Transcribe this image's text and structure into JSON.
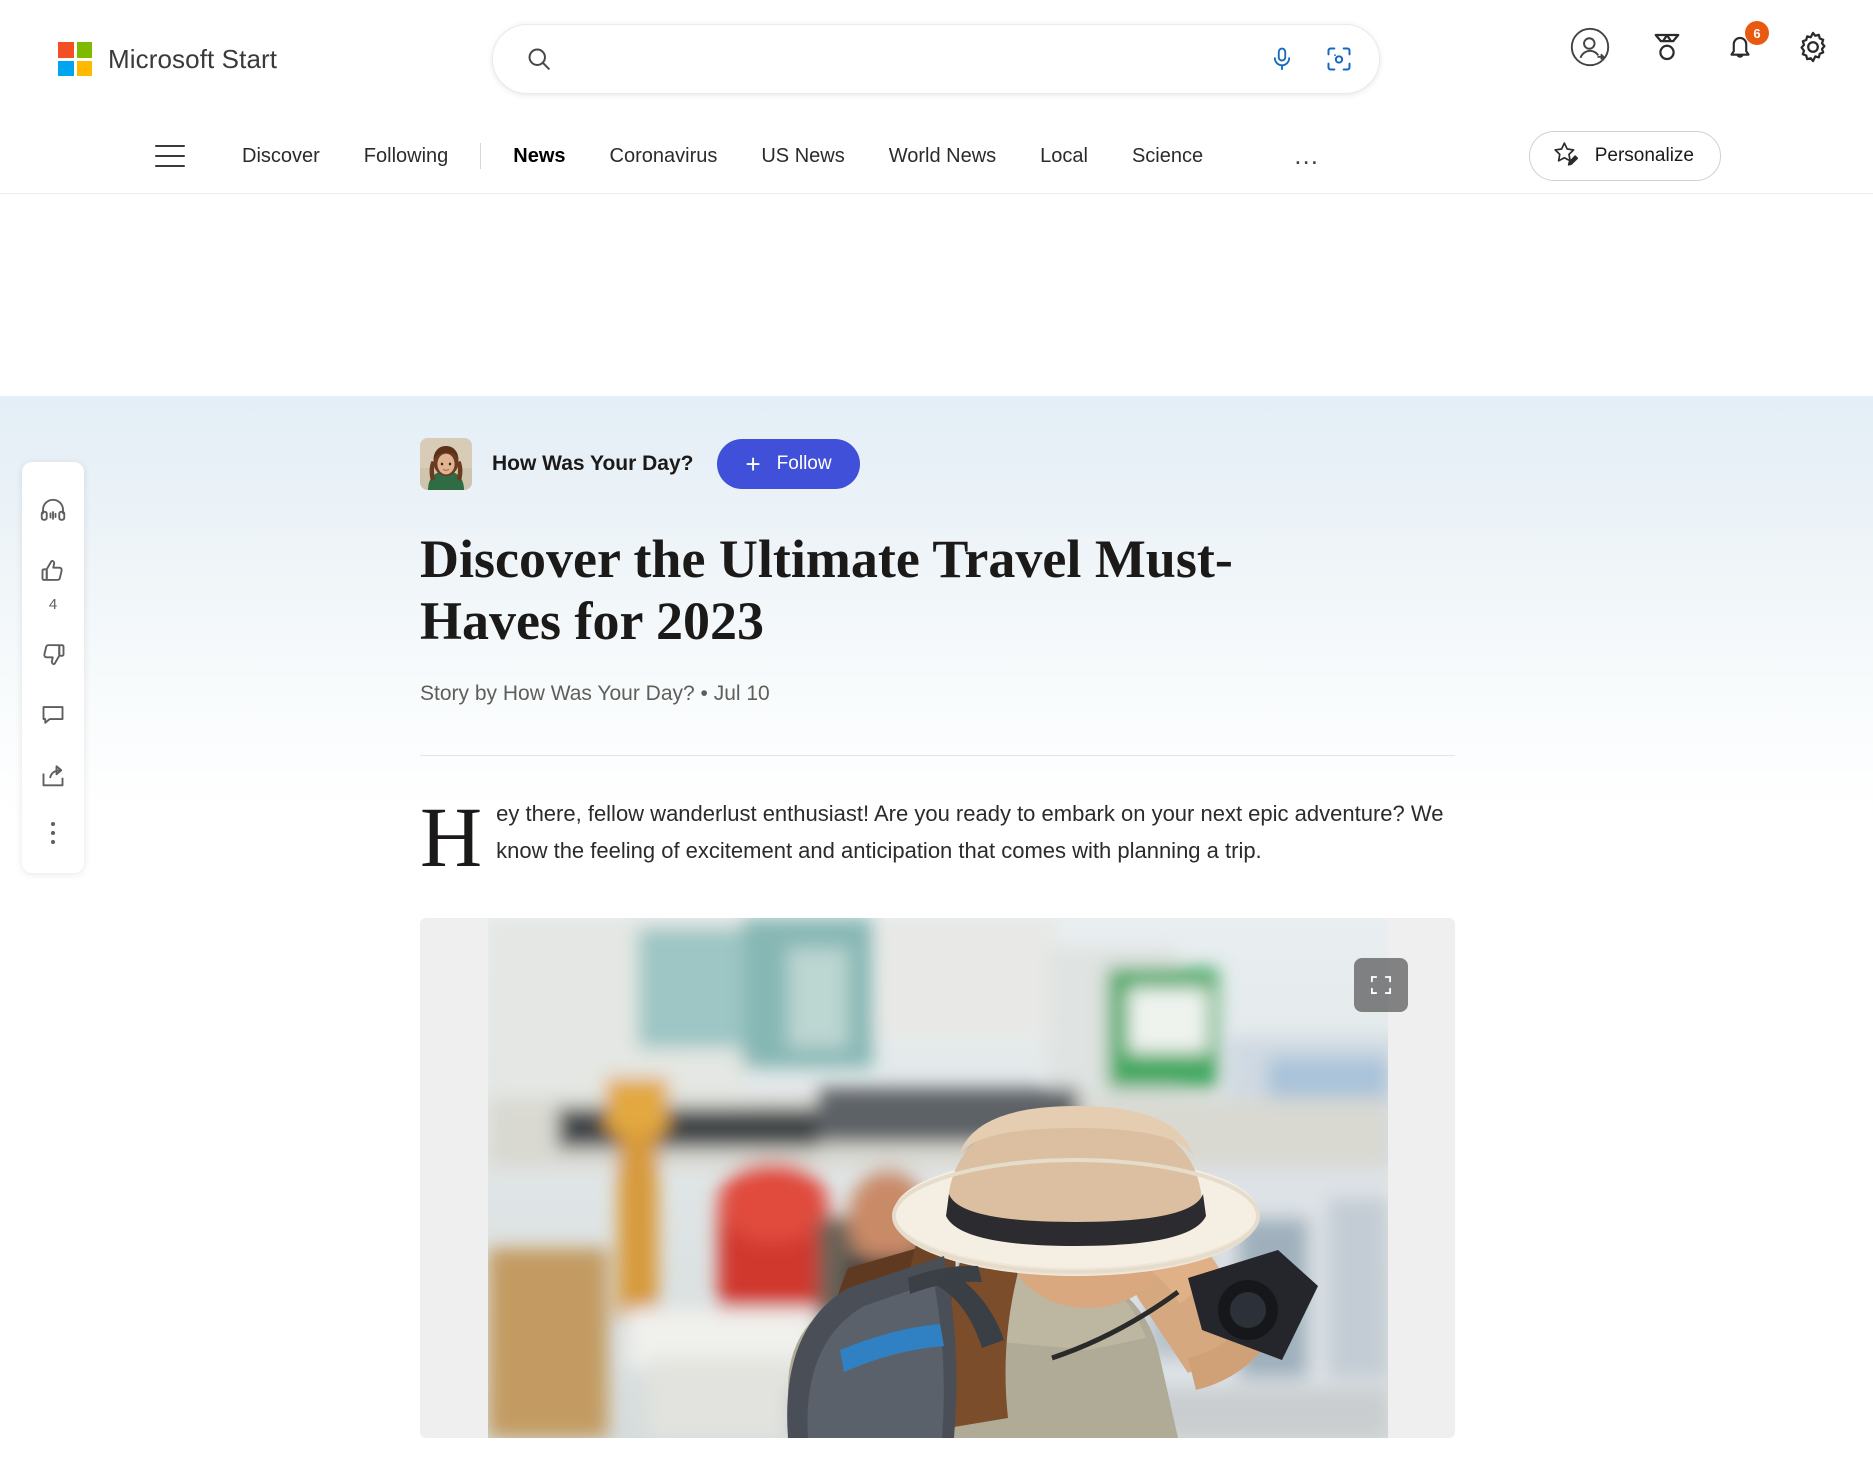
{
  "header": {
    "brand": "Microsoft Start",
    "logo_colors": [
      "#f25022",
      "#7fba00",
      "#00a4ef",
      "#ffb900"
    ],
    "search": {
      "value": "",
      "placeholder": "",
      "icons": [
        "search-icon",
        "microphone-icon",
        "visual-search-icon"
      ],
      "accent": "#0f6cbd"
    },
    "right_icons": [
      {
        "name": "sign-in-avatar-icon",
        "label": "Sign in"
      },
      {
        "name": "rewards-medal-icon",
        "label": "Rewards"
      },
      {
        "name": "notifications-bell-icon",
        "label": "Notifications",
        "badge": "6",
        "badge_color": "#e95a10"
      },
      {
        "name": "settings-gear-icon",
        "label": "Settings"
      }
    ]
  },
  "nav": {
    "menu_label": "Menu",
    "items": [
      {
        "label": "Discover",
        "active": false
      },
      {
        "label": "Following",
        "active": false
      },
      {
        "label": "News",
        "active": true
      },
      {
        "label": "Coronavirus",
        "active": false
      },
      {
        "label": "US News",
        "active": false
      },
      {
        "label": "World News",
        "active": false
      },
      {
        "label": "Local",
        "active": false
      },
      {
        "label": "Science",
        "active": false
      }
    ],
    "more_label": "…",
    "personalize_label": "Personalize"
  },
  "rail": {
    "items": [
      {
        "name": "listen-audio",
        "icon": "headphones-icon",
        "count": null
      },
      {
        "name": "like",
        "icon": "thumbs-up-icon",
        "count": "4"
      },
      {
        "name": "dislike",
        "icon": "thumbs-down-icon",
        "count": null
      },
      {
        "name": "comments",
        "icon": "comment-bubble-icon",
        "count": null
      },
      {
        "name": "share",
        "icon": "share-icon",
        "count": null
      },
      {
        "name": "more-options",
        "icon": "more-vertical-icon",
        "count": null
      }
    ],
    "like_count": "4"
  },
  "article": {
    "publisher": "How Was Your Day?",
    "follow_label": "Follow",
    "headline": "Discover the Ultimate Travel Must-Haves for 2023",
    "byline": "Story by How Was Your Day? • Jul 10",
    "paragraph_dropcap": "H",
    "paragraph_text": "ey there, fellow wanderlust enthusiast! Are you ready to embark on your next epic adventure? We know the feeling of excitement and anticipation that comes with planning a trip.",
    "hero_image_alt": "Woman in a panama hat with a backpack taking a photo on a busy city street",
    "hero_expand_label": "Expand image"
  }
}
